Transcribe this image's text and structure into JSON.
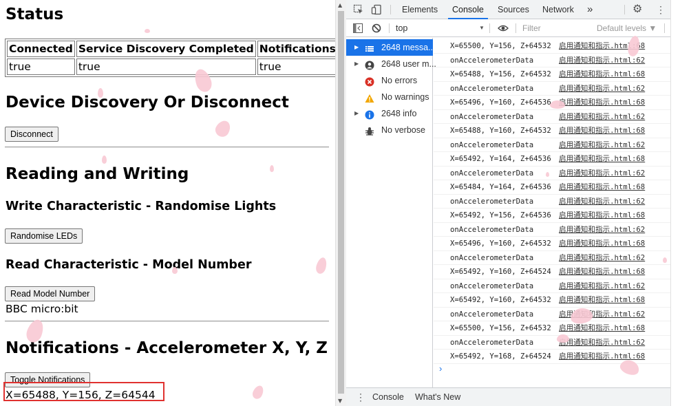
{
  "page": {
    "status_heading": "Status",
    "status_table": {
      "headers": [
        "Connected",
        "Service Discovery Completed",
        "Notifications"
      ],
      "values": [
        "true",
        "true",
        "true"
      ]
    },
    "discovery_heading": "Device Discovery Or Disconnect",
    "disconnect_button": "Disconnect",
    "rw_heading": "Reading and Writing",
    "write_heading": "Write Characteristic - Randomise Lights",
    "randomise_button": "Randomise LEDs",
    "read_heading": "Read Characteristic - Model Number",
    "read_button": "Read Model Number",
    "model_number": "BBC micro:bit",
    "notif_heading": "Notifications - Accelerometer X, Y, Z",
    "toggle_button": "Toggle Notifications",
    "accel_reading": "X=65488, Y=156, Z=64544"
  },
  "devtools": {
    "tabs": [
      "Elements",
      "Console",
      "Sources",
      "Network"
    ],
    "more_tabs": "»",
    "context": "top",
    "filter_placeholder": "Filter",
    "levels": "Default levels ▼",
    "sidebar": [
      {
        "label": "2648 messa...",
        "icon": "list-icon"
      },
      {
        "label": "2648 user m...",
        "icon": "user-icon"
      },
      {
        "label": "No errors",
        "icon": "error-icon"
      },
      {
        "label": "No warnings",
        "icon": "warning-icon"
      },
      {
        "label": "2648 info",
        "icon": "info-icon"
      },
      {
        "label": "No verbose",
        "icon": "bug-icon"
      }
    ],
    "logs": [
      {
        "msg": "X=65500, Y=156, Z+64532",
        "src": "启用通知和指示.html:68"
      },
      {
        "msg": "onAccelerometerData",
        "src": "启用通知和指示.html:62"
      },
      {
        "msg": "X=65488, Y=156, Z+64532",
        "src": "启用通知和指示.html:68"
      },
      {
        "msg": "onAccelerometerData",
        "src": "启用通知和指示.html:62"
      },
      {
        "msg": "X=65496, Y=160, Z+64536",
        "src": "启用通知和指示.html:68"
      },
      {
        "msg": "onAccelerometerData",
        "src": "启用通知和指示.html:62"
      },
      {
        "msg": "X=65488, Y=160, Z+64532",
        "src": "启用通知和指示.html:68"
      },
      {
        "msg": "onAccelerometerData",
        "src": "启用通知和指示.html:62"
      },
      {
        "msg": "X=65492, Y=164, Z+64536",
        "src": "启用通知和指示.html:68"
      },
      {
        "msg": "onAccelerometerData",
        "src": "启用通知和指示.html:62"
      },
      {
        "msg": "X=65484, Y=164, Z+64536",
        "src": "启用通知和指示.html:68"
      },
      {
        "msg": "onAccelerometerData",
        "src": "启用通知和指示.html:62"
      },
      {
        "msg": "X=65492, Y=156, Z+64536",
        "src": "启用通知和指示.html:68"
      },
      {
        "msg": "onAccelerometerData",
        "src": "启用通知和指示.html:62"
      },
      {
        "msg": "X=65496, Y=160, Z+64532",
        "src": "启用通知和指示.html:68"
      },
      {
        "msg": "onAccelerometerData",
        "src": "启用通知和指示.html:62"
      },
      {
        "msg": "X=65492, Y=160, Z+64524",
        "src": "启用通知和指示.html:68"
      },
      {
        "msg": "onAccelerometerData",
        "src": "启用通知和指示.html:62"
      },
      {
        "msg": "X=65492, Y=160, Z+64532",
        "src": "启用通知和指示.html:68"
      },
      {
        "msg": "onAccelerometerData",
        "src": "启用通知和指示.html:62"
      },
      {
        "msg": "X=65500, Y=156, Z+64532",
        "src": "启用通知和指示.html:68"
      },
      {
        "msg": "onAccelerometerData",
        "src": "启用通知和指示.html:62"
      },
      {
        "msg": "X=65492, Y=168, Z+64524",
        "src": "启用通知和指示.html:68"
      }
    ],
    "prompt": "›",
    "drawer": {
      "console": "Console",
      "whats_new": "What's New"
    }
  },
  "colors": {
    "highlight_box": "#e0312f",
    "devtools_accent": "#1a73e8",
    "petal": "#f8c9d4"
  }
}
